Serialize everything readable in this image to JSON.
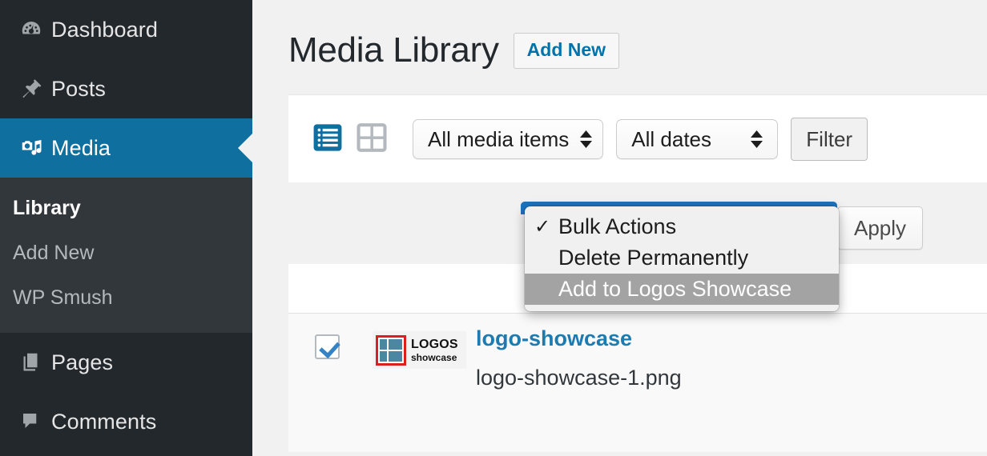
{
  "sidebar": {
    "items": [
      {
        "label": "Dashboard",
        "icon": "dashboard-icon",
        "current": false
      },
      {
        "label": "Posts",
        "icon": "pin-icon",
        "current": false
      },
      {
        "label": "Media",
        "icon": "media-icon",
        "current": true
      },
      {
        "label": "Pages",
        "icon": "pages-icon",
        "current": false
      },
      {
        "label": "Comments",
        "icon": "comments-icon",
        "current": false
      }
    ],
    "submenu": [
      {
        "label": "Library",
        "current": true
      },
      {
        "label": "Add New",
        "current": false
      },
      {
        "label": "WP Smush",
        "current": false
      }
    ],
    "colors": {
      "background": "#23282d",
      "submenu_background": "#32373c",
      "current_background": "#0f6f9e",
      "text": "#b4b9be"
    }
  },
  "header": {
    "title": "Media Library",
    "add_new_label": "Add New",
    "add_new_color": "#0073aa"
  },
  "toolbar": {
    "view_list_icon": "list-view-icon",
    "view_grid_icon": "grid-view-icon",
    "view_list_active": true,
    "media_type_filter": "All media items",
    "date_filter": "All dates",
    "filter_label": "Filter",
    "active_icon_color": "#0f6f9e",
    "inactive_icon_color": "#b4b9be"
  },
  "bulk": {
    "apply_label": "Apply",
    "selected_option": "Bulk Actions",
    "focus_ring_color": "#1e73be",
    "options": [
      {
        "label": "Bulk Actions",
        "checked": true,
        "highlighted": false
      },
      {
        "label": "Delete Permanently",
        "checked": false,
        "highlighted": false
      },
      {
        "label": "Add to Logos Showcase",
        "checked": false,
        "highlighted": true
      }
    ],
    "highlight_color": "#a3a3a3"
  },
  "table": {
    "rows": [
      {
        "checked": true,
        "thumbnail": {
          "word_top": "LOGOS",
          "word_bottom": "showcase",
          "border_color": "#d91f1f",
          "block_color": "#4b87a0"
        },
        "title": "logo-showcase",
        "title_color": "#1c7bb0",
        "filename": "logo-showcase-1.png"
      }
    ]
  }
}
